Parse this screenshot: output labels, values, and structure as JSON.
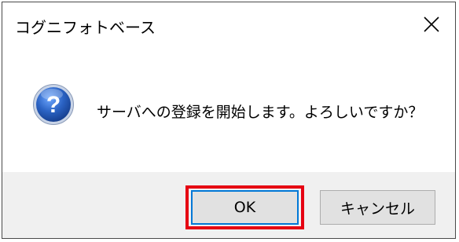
{
  "window": {
    "title": "コグニフォトベース"
  },
  "icons": {
    "close": "close-icon",
    "question": "question-icon"
  },
  "message": {
    "text": "サーバへの登録を開始します。よろしいですか？"
  },
  "buttons": {
    "ok_label": "OK",
    "cancel_label": "キャンセル"
  },
  "colors": {
    "highlight": "#e60012",
    "footer_bg": "#f0f0f0",
    "button_bg": "#e1e1e1",
    "default_button_border": "#0078d7",
    "icon_blue": "#1e5bb0"
  }
}
